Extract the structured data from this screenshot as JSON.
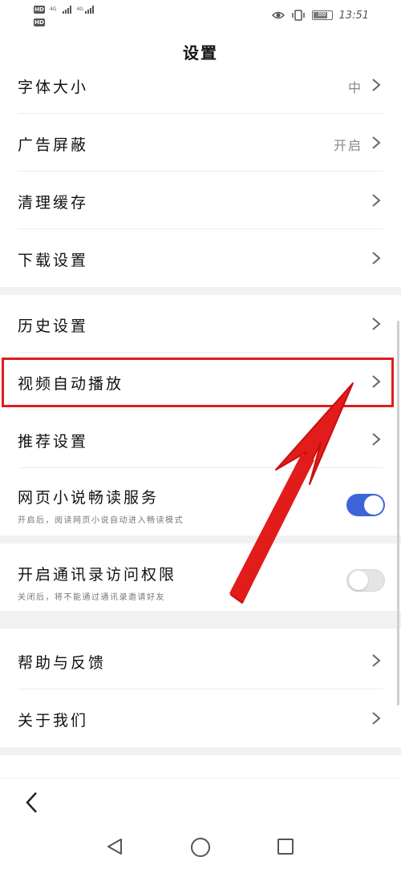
{
  "status_bar": {
    "hd_label": "HD",
    "network_tag": "4G",
    "time": "13:51",
    "battery": "88"
  },
  "header": {
    "title": "设置"
  },
  "settings": {
    "font_size": {
      "label": "字体大小",
      "value": "中"
    },
    "ad_block": {
      "label": "广告屏蔽",
      "value": "开启"
    },
    "clear_cache": {
      "label": "清理缓存"
    },
    "download": {
      "label": "下载设置"
    },
    "history": {
      "label": "历史设置"
    },
    "video_autoplay": {
      "label": "视频自动播放"
    },
    "recommend": {
      "label": "推荐设置"
    },
    "novel_reading": {
      "label": "网页小说畅读服务",
      "sub": "开启后，阅读网页小说自动进入畅读模式",
      "enabled": true
    },
    "contacts_access": {
      "label": "开启通讯录访问权限",
      "sub": "关闭后，将不能通过通讯录邀请好友",
      "enabled": false
    },
    "help": {
      "label": "帮助与反馈"
    },
    "about": {
      "label": "关于我们"
    }
  },
  "annotation": {
    "arrow_color": "#e21b1b",
    "box_color": "#e21b1b"
  },
  "colors": {
    "toggle_on": "#3d64d8",
    "toggle_off": "#e4e4e4"
  }
}
